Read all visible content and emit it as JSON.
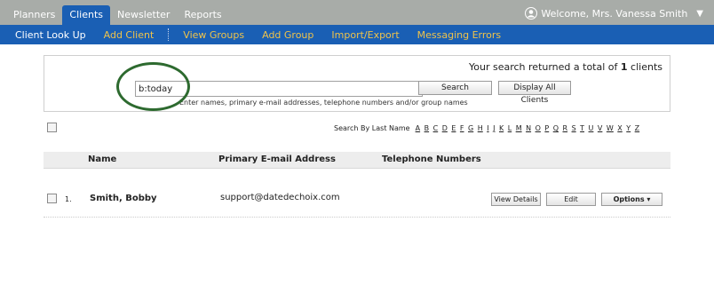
{
  "top_nav": {
    "tabs": [
      "Planners",
      "Clients",
      "Newsletter",
      "Reports"
    ],
    "welcome": "Welcome, Mrs. Vanessa Smith",
    "menu_caret": "▼"
  },
  "sub_nav": {
    "items": [
      "Client Look Up",
      "Add Client",
      "View Groups",
      "Add Group",
      "Import/Export",
      "Messaging Errors"
    ]
  },
  "search": {
    "result_prefix": "Your search returned a total of",
    "result_count": "1",
    "result_suffix": "clients",
    "input_value": "b:today",
    "search_label": "Search",
    "display_all_label": "Display All Clients",
    "hint": "Enter names, primary e-mail addresses, telephone numbers and/or group names"
  },
  "alpha_filter": {
    "label": "Search By Last Name",
    "letters": [
      "A",
      "B",
      "C",
      "D",
      "E",
      "F",
      "G",
      "H",
      "I",
      "J",
      "K",
      "L",
      "M",
      "N",
      "O",
      "P",
      "Q",
      "R",
      "S",
      "T",
      "U",
      "V",
      "W",
      "X",
      "Y",
      "Z"
    ]
  },
  "table": {
    "columns": [
      "Name",
      "Primary E-mail Address",
      "Telephone Numbers"
    ],
    "rows": [
      {
        "index": "1.",
        "name": "Smith, Bobby",
        "email": "support@datedechoix.com",
        "view_label": "View Details",
        "edit_label": "Edit",
        "options_label": "Options ▾"
      }
    ]
  },
  "colors": {
    "nav_bg": "#a8aca8",
    "active_tab": "#1a5fb4",
    "subnav_link": "#f0c34a",
    "annotation_circle": "#2d6a2f"
  }
}
